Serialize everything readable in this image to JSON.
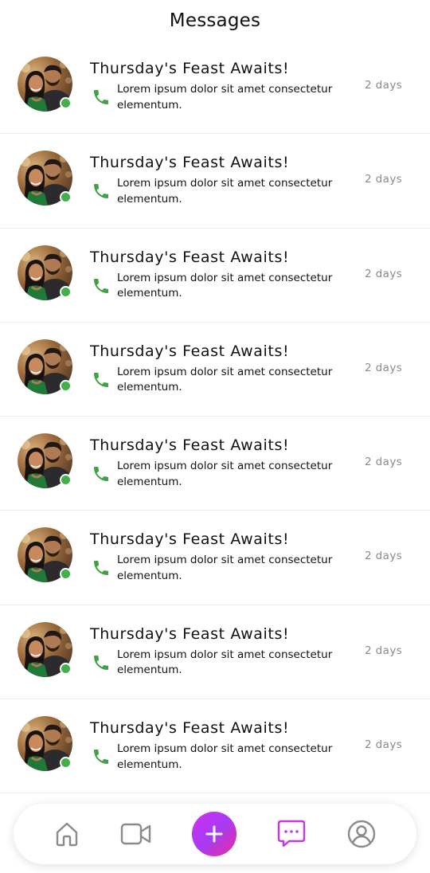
{
  "header": {
    "title": "Messages"
  },
  "messages": [
    {
      "title": "Thursday's Feast Awaits!",
      "preview": "Lorem ipsum dolor sit amet consectetur elementum.",
      "time": "2 days",
      "online": true
    },
    {
      "title": "Thursday's Feast Awaits!",
      "preview": "Lorem ipsum dolor sit amet consectetur elementum.",
      "time": "2 days",
      "online": true
    },
    {
      "title": "Thursday's Feast Awaits!",
      "preview": "Lorem ipsum dolor sit amet consectetur elementum.",
      "time": "2 days",
      "online": true
    },
    {
      "title": "Thursday's Feast Awaits!",
      "preview": "Lorem ipsum dolor sit amet consectetur elementum.",
      "time": "2 days",
      "online": true
    },
    {
      "title": "Thursday's Feast Awaits!",
      "preview": "Lorem ipsum dolor sit amet consectetur elementum.",
      "time": "2 days",
      "online": true
    },
    {
      "title": "Thursday's Feast Awaits!",
      "preview": "Lorem ipsum dolor sit amet consectetur elementum.",
      "time": "2 days",
      "online": true
    },
    {
      "title": "Thursday's Feast Awaits!",
      "preview": "Lorem ipsum dolor sit amet consectetur elementum.",
      "time": "2 days",
      "online": true
    },
    {
      "title": "Thursday's Feast Awaits!",
      "preview": "Lorem ipsum dolor sit amet consectetur elementum.",
      "time": "2 days",
      "online": true
    }
  ],
  "tabbar": {
    "items": [
      {
        "icon": "home-icon",
        "active": false
      },
      {
        "icon": "video-icon",
        "active": false
      },
      {
        "icon": "add-icon",
        "active": false
      },
      {
        "icon": "chat-icon",
        "active": true
      },
      {
        "icon": "profile-icon",
        "active": false
      }
    ]
  },
  "colors": {
    "online": "#43b047",
    "phone": "#43a047",
    "accent": "#c237e8",
    "inactive_icon": "#8a8a8a",
    "time_text": "#8a8a8a"
  }
}
